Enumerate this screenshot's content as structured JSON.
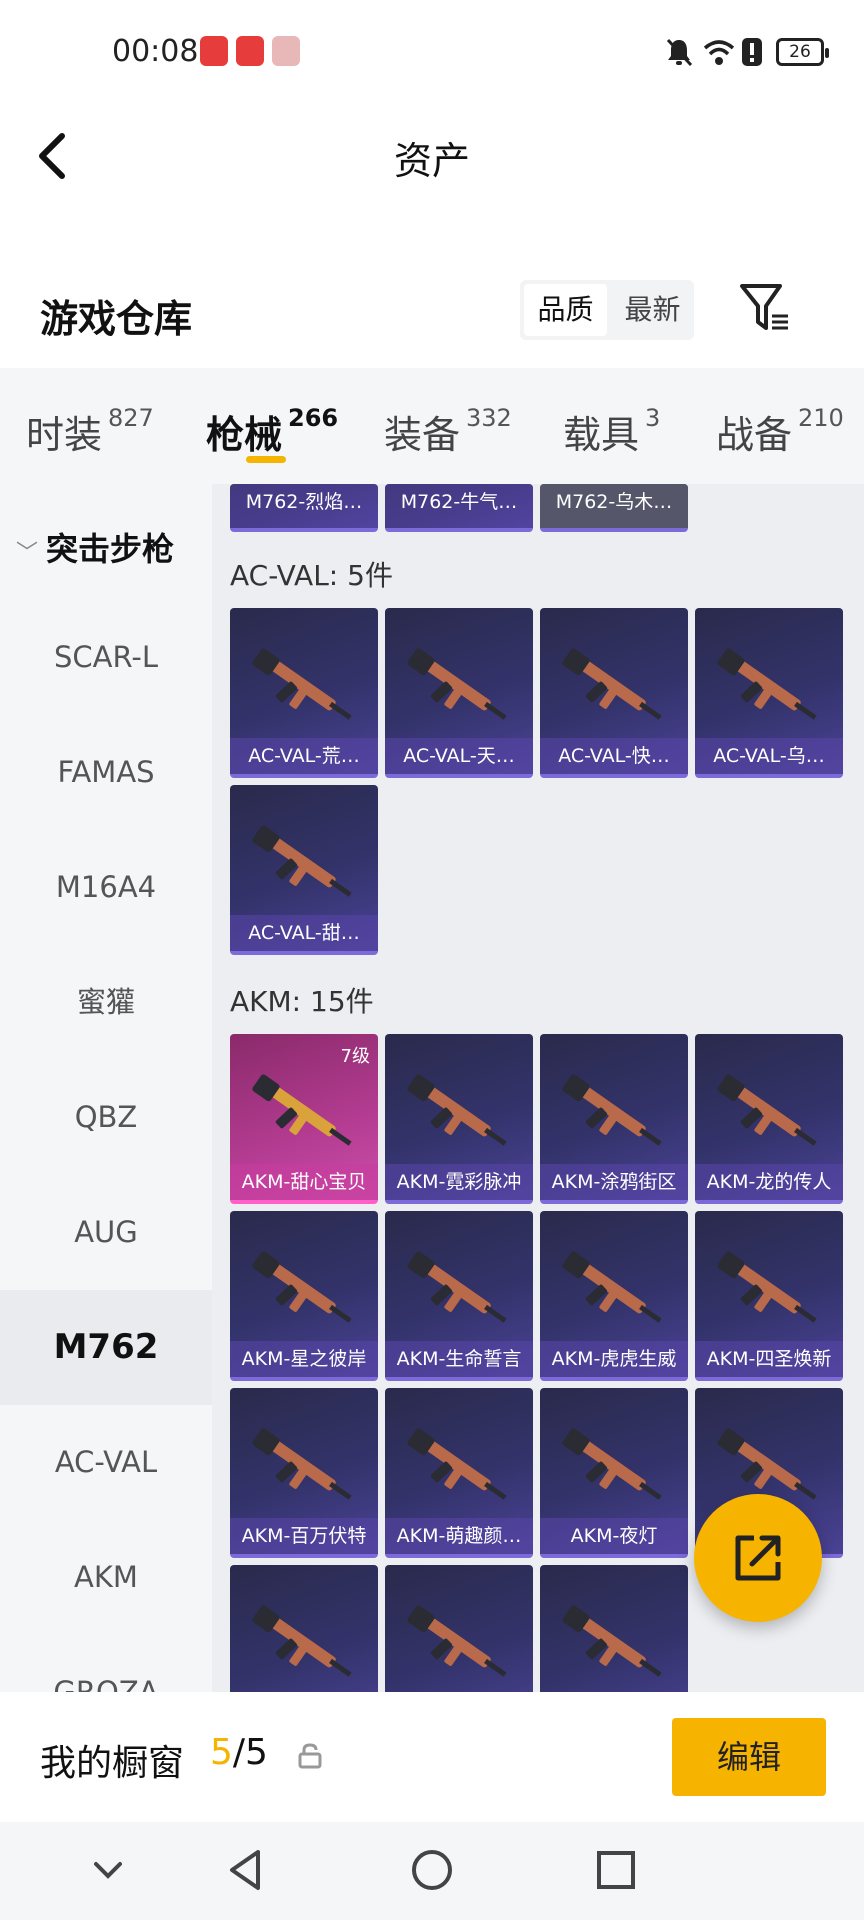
{
  "status_bar": {
    "time": "00:08",
    "battery": "26"
  },
  "header": {
    "title": "资产"
  },
  "warehouse": {
    "title": "游戏仓库",
    "sort_options": [
      "品质",
      "最新"
    ]
  },
  "category_tabs": [
    {
      "label": "时装",
      "count": "827"
    },
    {
      "label": "枪械",
      "count": "266"
    },
    {
      "label": "装备",
      "count": "332"
    },
    {
      "label": "载具",
      "count": "3"
    },
    {
      "label": "战备",
      "count": "210"
    }
  ],
  "sidebar": {
    "group": "突击步枪",
    "items": [
      "SCAR-L",
      "FAMAS",
      "M16A4",
      "蜜獾",
      "QBZ",
      "AUG",
      "M762",
      "AC-VAL",
      "AKM",
      "GROZA"
    ]
  },
  "grid": {
    "top_cards": [
      "M762-烈焰…",
      "M762-牛气…",
      "M762-乌木…"
    ],
    "sections": [
      {
        "title": "AC-VAL: 5件",
        "cards": [
          "AC-VAL-荒…",
          "AC-VAL-天…",
          "AC-VAL-快…",
          "AC-VAL-乌…",
          "AC-VAL-甜…"
        ]
      },
      {
        "title": "AKM: 15件",
        "cards": [
          "AKM-甜心宝贝",
          "AKM-霓彩脉冲",
          "AKM-涂鸦街区",
          "AKM-龙的传人",
          "AKM-星之彼岸",
          "AKM-生命誓言",
          "AKM-虎虎生威",
          "AKM-四圣焕新",
          "AKM-百万伏特",
          "AKM-萌趣颜…",
          "AKM-夜灯",
          "",
          "",
          "",
          ""
        ],
        "badge": "7级"
      }
    ]
  },
  "showcase": {
    "title": "我的橱窗",
    "current": "5",
    "total": "/5",
    "edit_label": "编辑"
  },
  "colors": {
    "accent": "#f6b300",
    "card_purple": "#33336b",
    "card_pink": "#b43c92"
  }
}
